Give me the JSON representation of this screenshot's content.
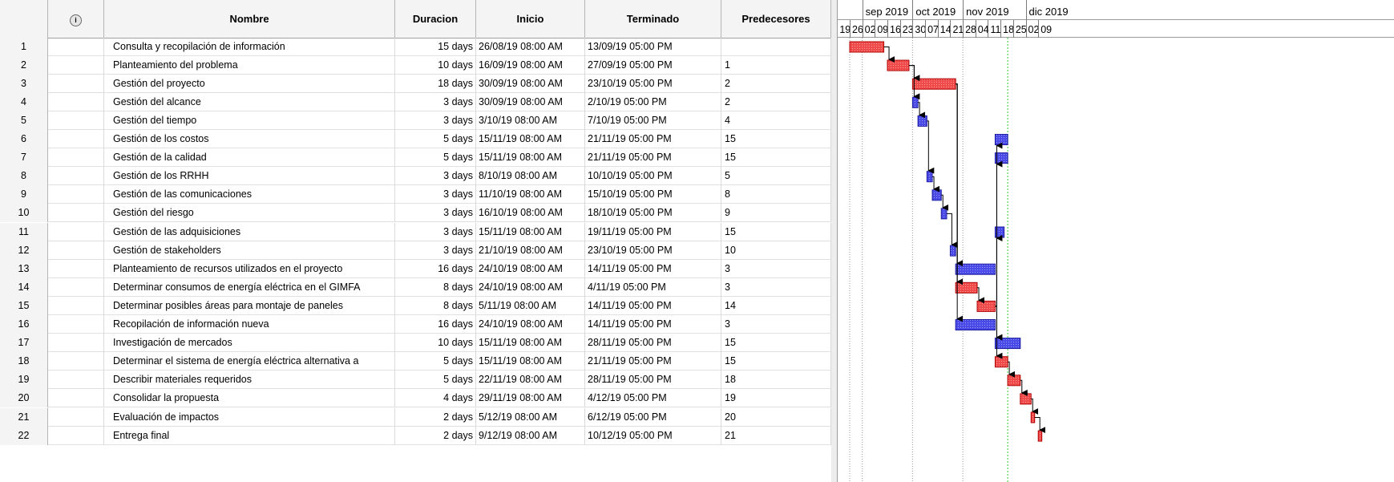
{
  "columns": {
    "info_icon": "info-icon",
    "name": "Nombre",
    "duration": "Duracion",
    "start": "Inicio",
    "finish": "Terminado",
    "predecessors": "Predecesores"
  },
  "tasks": [
    {
      "id": "1",
      "name": "Consulta y recopilación de información",
      "duration": "15 days",
      "start": "26/08/19 08:00 AM",
      "finish": "13/09/19 05:00 PM",
      "pred": "",
      "critical": true
    },
    {
      "id": "2",
      "name": "Planteamiento del problema",
      "duration": "10 days",
      "start": "16/09/19 08:00 AM",
      "finish": "27/09/19 05:00 PM",
      "pred": "1",
      "critical": true
    },
    {
      "id": "3",
      "name": "Gestión del proyecto",
      "duration": "18 days",
      "start": "30/09/19 08:00 AM",
      "finish": "23/10/19 05:00 PM",
      "pred": "2",
      "critical": true
    },
    {
      "id": "4",
      "name": "Gestión del alcance",
      "duration": "3 days",
      "start": "30/09/19 08:00 AM",
      "finish": "2/10/19 05:00 PM",
      "pred": "2",
      "critical": false
    },
    {
      "id": "5",
      "name": "Gestión del tiempo",
      "duration": "3 days",
      "start": "3/10/19 08:00 AM",
      "finish": "7/10/19 05:00 PM",
      "pred": "4",
      "critical": false
    },
    {
      "id": "6",
      "name": "Gestión de los costos",
      "duration": "5 days",
      "start": "15/11/19 08:00 AM",
      "finish": "21/11/19 05:00 PM",
      "pred": "15",
      "critical": false
    },
    {
      "id": "7",
      "name": "Gestión de la calidad",
      "duration": "5 days",
      "start": "15/11/19 08:00 AM",
      "finish": "21/11/19 05:00 PM",
      "pred": "15",
      "critical": false
    },
    {
      "id": "8",
      "name": "Gestión de los RRHH",
      "duration": "3 days",
      "start": "8/10/19 08:00 AM",
      "finish": "10/10/19 05:00 PM",
      "pred": "5",
      "critical": false
    },
    {
      "id": "9",
      "name": "Gestión de las comunicaciones",
      "duration": "3 days",
      "start": "11/10/19 08:00 AM",
      "finish": "15/10/19 05:00 PM",
      "pred": "8",
      "critical": false
    },
    {
      "id": "10",
      "name": "Gestión del riesgo",
      "duration": "3 days",
      "start": "16/10/19 08:00 AM",
      "finish": "18/10/19 05:00 PM",
      "pred": "9",
      "critical": false
    },
    {
      "id": "11",
      "name": "Gestión de las adquisiciones",
      "duration": "3 days",
      "start": "15/11/19 08:00 AM",
      "finish": "19/11/19 05:00 PM",
      "pred": "15",
      "critical": false
    },
    {
      "id": "12",
      "name": "Gestión de stakeholders",
      "duration": "3 days",
      "start": "21/10/19 08:00 AM",
      "finish": "23/10/19 05:00 PM",
      "pred": "10",
      "critical": false
    },
    {
      "id": "13",
      "name": "Planteamiento de recursos utilizados en el proyecto",
      "duration": "16 days",
      "start": "24/10/19 08:00 AM",
      "finish": "14/11/19 05:00 PM",
      "pred": "3",
      "critical": false
    },
    {
      "id": "14",
      "name": "Determinar consumos de energía eléctrica en el GIMFA",
      "duration": "8 days",
      "start": "24/10/19 08:00 AM",
      "finish": "4/11/19 05:00 PM",
      "pred": "3",
      "critical": true
    },
    {
      "id": "15",
      "name": "Determinar posibles áreas para montaje de paneles",
      "duration": "8 days",
      "start": "5/11/19 08:00 AM",
      "finish": "14/11/19 05:00 PM",
      "pred": "14",
      "critical": true
    },
    {
      "id": "16",
      "name": "Recopilación de información nueva",
      "duration": "16 days",
      "start": "24/10/19 08:00 AM",
      "finish": "14/11/19 05:00 PM",
      "pred": "3",
      "critical": false
    },
    {
      "id": "17",
      "name": "Investigación de mercados",
      "duration": "10 days",
      "start": "15/11/19 08:00 AM",
      "finish": "28/11/19 05:00 PM",
      "pred": "15",
      "critical": false
    },
    {
      "id": "18",
      "name": "Determinar el sistema de energía eléctrica alternativa a",
      "duration": "5 days",
      "start": "15/11/19 08:00 AM",
      "finish": "21/11/19 05:00 PM",
      "pred": "15",
      "critical": true
    },
    {
      "id": "19",
      "name": "Describir materiales requeridos",
      "duration": "5 days",
      "start": "22/11/19 08:00 AM",
      "finish": "28/11/19 05:00 PM",
      "pred": "18",
      "critical": true
    },
    {
      "id": "20",
      "name": "Consolidar la propuesta",
      "duration": "4 days",
      "start": "29/11/19 08:00 AM",
      "finish": "4/12/19 05:00 PM",
      "pred": "19",
      "critical": true
    },
    {
      "id": "21",
      "name": "Evaluación de impactos",
      "duration": "2 days",
      "start": "5/12/19 08:00 AM",
      "finish": "6/12/19 05:00 PM",
      "pred": "20",
      "critical": true
    },
    {
      "id": "22",
      "name": "Entrega final",
      "duration": "2 days",
      "start": "9/12/19 08:00 AM",
      "finish": "10/12/19 05:00 PM",
      "pred": "21",
      "critical": true
    }
  ],
  "timeline": {
    "months": [
      "sep 2019",
      "oct 2019",
      "nov 2019",
      "dic 2019"
    ],
    "weeks": [
      "19",
      "26",
      "02",
      "09",
      "16",
      "23",
      "30",
      "07",
      "14",
      "21",
      "28",
      "04",
      "11",
      "18",
      "25",
      "02",
      "09"
    ]
  },
  "colors": {
    "critical_bar": "#ef4b4b",
    "normal_bar": "#4a4ae6",
    "arrow": "#000000",
    "today_line": "#33cc33"
  }
}
